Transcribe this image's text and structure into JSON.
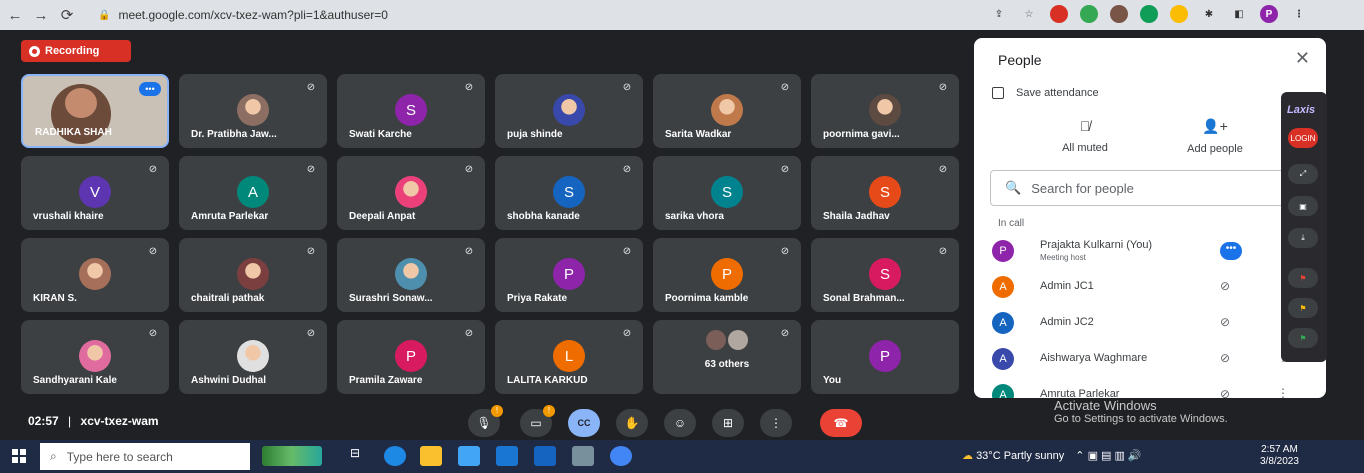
{
  "browser": {
    "url": "meet.google.com/xcv-txez-wam?pli=1&authuser=0",
    "profile_initial": "P"
  },
  "recording_label": "Recording",
  "tiles": [
    {
      "name": "RADHIKA SHAH",
      "kind": "video"
    },
    {
      "name": "Dr. Pratibha Jaw...",
      "kind": "photo",
      "color": "#8d6e63"
    },
    {
      "name": "Swati Karche",
      "kind": "initial",
      "initial": "S",
      "color": "#8e24aa"
    },
    {
      "name": "puja shinde",
      "kind": "photo",
      "color": "#3949ab"
    },
    {
      "name": "Sarita Wadkar",
      "kind": "photo",
      "color": "#c0794b"
    },
    {
      "name": "poornima gavi...",
      "kind": "photo",
      "color": "#5d4a40"
    },
    {
      "name": "vrushali khaire",
      "kind": "initial",
      "initial": "V",
      "color": "#5e35b1"
    },
    {
      "name": "Amruta Parlekar",
      "kind": "initial",
      "initial": "A",
      "color": "#00897b"
    },
    {
      "name": "Deepali Anpat",
      "kind": "photo",
      "color": "#ec407a"
    },
    {
      "name": "shobha kanade",
      "kind": "initial",
      "initial": "S",
      "color": "#1565c0"
    },
    {
      "name": "sarika vhora",
      "kind": "initial",
      "initial": "S",
      "color": "#00838f"
    },
    {
      "name": "Shaila Jadhav",
      "kind": "initial",
      "initial": "S",
      "color": "#e64a19"
    },
    {
      "name": "KIRAN S.",
      "kind": "photo",
      "color": "#a56f5a"
    },
    {
      "name": "chaitrali pathak",
      "kind": "photo",
      "color": "#7b3f3f"
    },
    {
      "name": "Surashri Sonaw...",
      "kind": "photo",
      "color": "#4f8fae"
    },
    {
      "name": "Priya Rakate",
      "kind": "initial",
      "initial": "P",
      "color": "#8e24aa"
    },
    {
      "name": "Poornima kamble",
      "kind": "initial",
      "initial": "P",
      "color": "#ef6c00"
    },
    {
      "name": "Sonal Brahman...",
      "kind": "initial",
      "initial": "S",
      "color": "#d81b60"
    },
    {
      "name": "Sandhyarani Kale",
      "kind": "photo",
      "color": "#e06c9f"
    },
    {
      "name": "Ashwini Dudhal",
      "kind": "photo",
      "color": "#e0e0e0"
    },
    {
      "name": "Pramila Zaware",
      "kind": "initial",
      "initial": "P",
      "color": "#d81b60"
    },
    {
      "name": "LALITA KARKUD",
      "kind": "initial",
      "initial": "L",
      "color": "#ef6c00"
    },
    {
      "name": "63 others",
      "kind": "others"
    },
    {
      "name": "You",
      "kind": "initial",
      "initial": "P",
      "color": "#8e24aa"
    }
  ],
  "footer": {
    "time": "02:57",
    "separator": "|",
    "meeting_code": "xcv-txez-wam",
    "cc_label": "CC"
  },
  "people": {
    "title": "People",
    "save_attendance": "Save attendance",
    "all_muted": "All muted",
    "add_people": "Add people",
    "search_placeholder": "Search for people",
    "in_call": "In call",
    "list": [
      {
        "name": "Prajakta Kulkarni (You)",
        "sub": "Meeting host",
        "initial": "P",
        "color": "#8e24aa"
      },
      {
        "name": "Admin JC1",
        "sub": "",
        "initial": "A",
        "color": "#ef6c00"
      },
      {
        "name": "Admin JC2",
        "sub": "",
        "initial": "A",
        "color": "#1565c0"
      },
      {
        "name": "Aishwarya Waghmare",
        "sub": "",
        "initial": "A",
        "color": "#3949ab"
      },
      {
        "name": "Amruta Parlekar",
        "sub": "",
        "initial": "A",
        "color": "#00897b"
      }
    ]
  },
  "laxis": {
    "logo": "Laxis",
    "login": "LOGIN"
  },
  "watermark": {
    "line1": "Activate Windows",
    "line2": "Go to Settings to activate Windows."
  },
  "taskbar": {
    "search_placeholder": "Type here to search",
    "weather": "33°C  Partly sunny",
    "time": "2:57 AM",
    "date": "3/8/2023"
  }
}
